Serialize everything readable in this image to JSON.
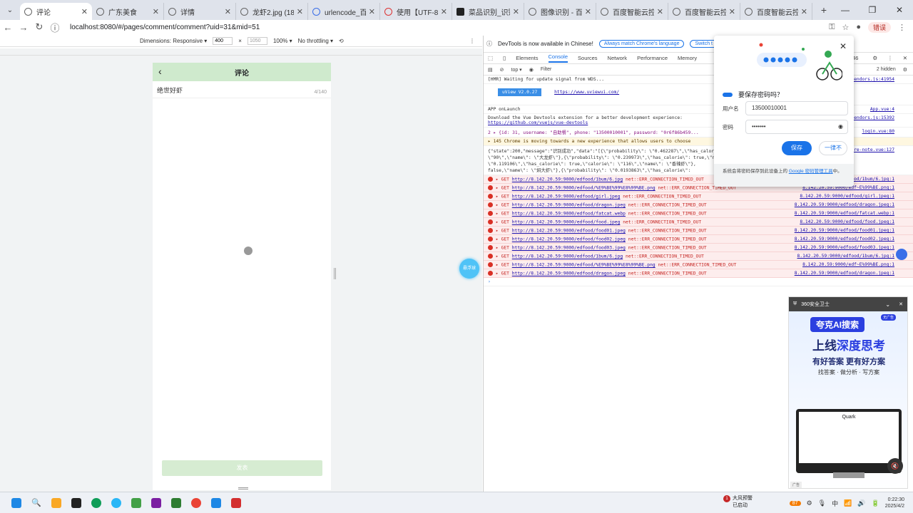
{
  "tabs": [
    {
      "title": "评论",
      "active": true,
      "fav": "globe"
    },
    {
      "title": "广东美食",
      "fav": "globe"
    },
    {
      "title": "详情",
      "fav": "globe"
    },
    {
      "title": "龙虾2.jpg (187%)",
      "fav": "globe"
    },
    {
      "title": "urlencode_百度",
      "fav": "blue"
    },
    {
      "title": "使用【UTF-8】",
      "fav": "red"
    },
    {
      "title": "菜品识别_识别",
      "fav": "ai"
    },
    {
      "title": "图像识别 - 百度",
      "fav": "globe"
    },
    {
      "title": "百度智能云控制台",
      "fav": "globe"
    },
    {
      "title": "百度智能云控制台",
      "fav": "globe"
    },
    {
      "title": "百度智能云控制台",
      "fav": "globe"
    }
  ],
  "address": {
    "url": "localhost:8080/#/pages/comment/comment?uid=31&mid=51",
    "error_label": "错误"
  },
  "devbar": {
    "dimensions": "Dimensions: Responsive ▾",
    "width": "400",
    "times": "×",
    "height": "1050",
    "zoom": "100% ▾",
    "throttle": "No throttling ▾"
  },
  "phone": {
    "title": "评论",
    "comment_text": "绝世好虾",
    "char_count": "4/140",
    "submit_label": "发表"
  },
  "float_ball": "悬浮球",
  "devtools": {
    "info_text": "DevTools is now available in Chinese!",
    "info_btn1": "Always match Chrome's language",
    "info_btn2": "Switch t",
    "tabs": [
      "Elements",
      "Console",
      "Sources",
      "Network",
      "Performance",
      "Memory"
    ],
    "active_tab": "Console",
    "filter_top": "top ▾",
    "filter_label": "Filter",
    "hidden": "2 hidden",
    "issues": "146",
    "uview_badge": "uView V2.0.27",
    "uview_link": "https://www.uviewui.com/",
    "lines": [
      {
        "text": "[HMR] Waiting for update signal from WDS...",
        "src": "vendors.js:41954"
      },
      {
        "text": "APP onLaunch",
        "src": "App.vue:4"
      },
      {
        "text": "Download the Vue Devtools extension for a better development experience:",
        "src": "vendors.js:15392"
      },
      {
        "text": "https://github.com/vuejs/vue-devtools",
        "src": ""
      },
      {
        "text": "2 ▸ {id: 31, username: \"自助餐\", phone: \"13500010001\", password: \"0r6f86b459...",
        "src": "login.vue:80"
      },
      {
        "text": "▸ 145  Chrome is moving towards a new experience that allows users to choose",
        "src": ""
      },
      {
        "text": "{\"state\":200,\"message\":\"识别成功\",\"data\":\"[{\\\"probability\\\": \\\"0.462287\\\",\\\"has_calorie\\\": true,\\\"calorie\\\":",
        "src": "picture-note.vue:127"
      },
      {
        "text": "\\\"90\\\",\\\"name\\\": \\\"大龙虾\\\"},{\\\"probability\\\": \\\"0.239973\\\",\\\"has_calorie\\\": true,\\\"name\\\":\\\"probability\\\":",
        "src": ""
      },
      {
        "text": "\\\"0.119106\\\",\\\"has_calorie\\\": true,\\\"calorie\\\": \\\"116\\\",\\\"name\\\": \\\"香辣虾\\\"},",
        "src": ""
      },
      {
        "text": "false,\\\"name\\\": \\\"焖大虾\\\"},{\\\"probability\\\": \\\"0.0193863\\\",\\\"has_calorie\\\":",
        "src": ""
      }
    ],
    "errors": [
      {
        "url": "http://8.142.20.59:9000/edfood/1bum/6.jpg",
        "msg": "net::ERR_CONNECTION_TIMED_OUT",
        "src": "8.142.20.59:9000/edfood/1bum/6.jpg:1"
      },
      {
        "url": "http://8.142.20.59:9000/edfood/%E9%BE%99%E8%99%BE.png",
        "msg": "net::ERR_CONNECTION_TIMED_OUT",
        "src": "8.142.20.59:9000/edf~E%99%BE.png:1"
      },
      {
        "url": "http://8.142.20.59:9000/edfood/girl.jpeg",
        "msg": "net::ERR_CONNECTION_TIMED_OUT",
        "src": "8.142.20.59:9000/edfood/girl.jpeg:1"
      },
      {
        "url": "http://8.142.20.59:9000/edfood/dragon.jpeg",
        "msg": "net::ERR_CONNECTION_TIMED_OUT",
        "src": "8.142.20.59:9000/edfood/dragon.jpeg:1"
      },
      {
        "url": "http://8.142.20.59:9000/edfood/fatcat.webp",
        "msg": "net::ERR_CONNECTION_TIMED_OUT",
        "src": "8.142.20.59:9000/edfood/fatcat.webp:1"
      },
      {
        "url": "http://8.142.20.59:9000/edfood/food.jpeg",
        "msg": "net::ERR_CONNECTION_TIMED_OUT",
        "src": "8.142.20.59:9000/edfood/food.jpeg:1"
      },
      {
        "url": "http://8.142.20.59:9000/edfood/food01.jpeg",
        "msg": "net::ERR_CONNECTION_TIMED_OUT",
        "src": "8.142.20.59:9000/edfood/food01.jpeg:1"
      },
      {
        "url": "http://8.142.20.59:9000/edfood/food02.jpeg",
        "msg": "net::ERR_CONNECTION_TIMED_OUT",
        "src": "8.142.20.59:9000/edfood/food02.jpeg:1"
      },
      {
        "url": "http://8.142.20.59:9000/edfood/food03.jpeg",
        "msg": "net::ERR_CONNECTION_TIMED_OUT",
        "src": "8.142.20.59:9000/edfood/food03.jpeg:1"
      },
      {
        "url": "http://8.142.20.59:9000/edfood/1bum/6.jpg",
        "msg": "net::ERR_CONNECTION_TIMED_OUT",
        "src": "8.142.20.59:9000/edfood/1bum/6.jpg:1"
      },
      {
        "url": "http://8.142.20.59:9000/edfood/%E9%BE%99%E8%99%BE.png",
        "msg": "net::ERR_CONNECTION_TIMED_OUT",
        "src": "8.142.20.59:9000/edf~E%99%BE.png:1"
      },
      {
        "url": "http://8.142.20.59:9000/edfood/dragon.jpeg",
        "msg": "net::ERR_CONNECTION_TIMED_OUT",
        "src": "8.142.20.59:9000/edfood/dragon.jpeg:1"
      }
    ]
  },
  "password_popup": {
    "title": "要保存密码吗？",
    "username_label": "用户名",
    "username_value": "13500010001",
    "password_label": "密码",
    "password_value": "•••••••",
    "save_label": "保存",
    "never_label": "一律不",
    "footer_text": "系统会将密码保存到此设备上的",
    "footer_link": "Google 密码管理工具",
    "footer_end": "中。"
  },
  "quark_ad": {
    "top_label": "360安全卫士",
    "pill": "夸克AI搜索",
    "badge": "无广告",
    "headline_a": "上线",
    "headline_b": "深度思考",
    "sub": "有好答案 更有好方案",
    "tags": "找答案 · 做分析 · 写方案",
    "screen_label": "Quark",
    "ad_tag": "广告"
  },
  "taskbar": {
    "news_title": "大风预警",
    "news_sub": "已启动",
    "temp": "87",
    "time": "0:22:30",
    "date": "2025/4/2"
  }
}
